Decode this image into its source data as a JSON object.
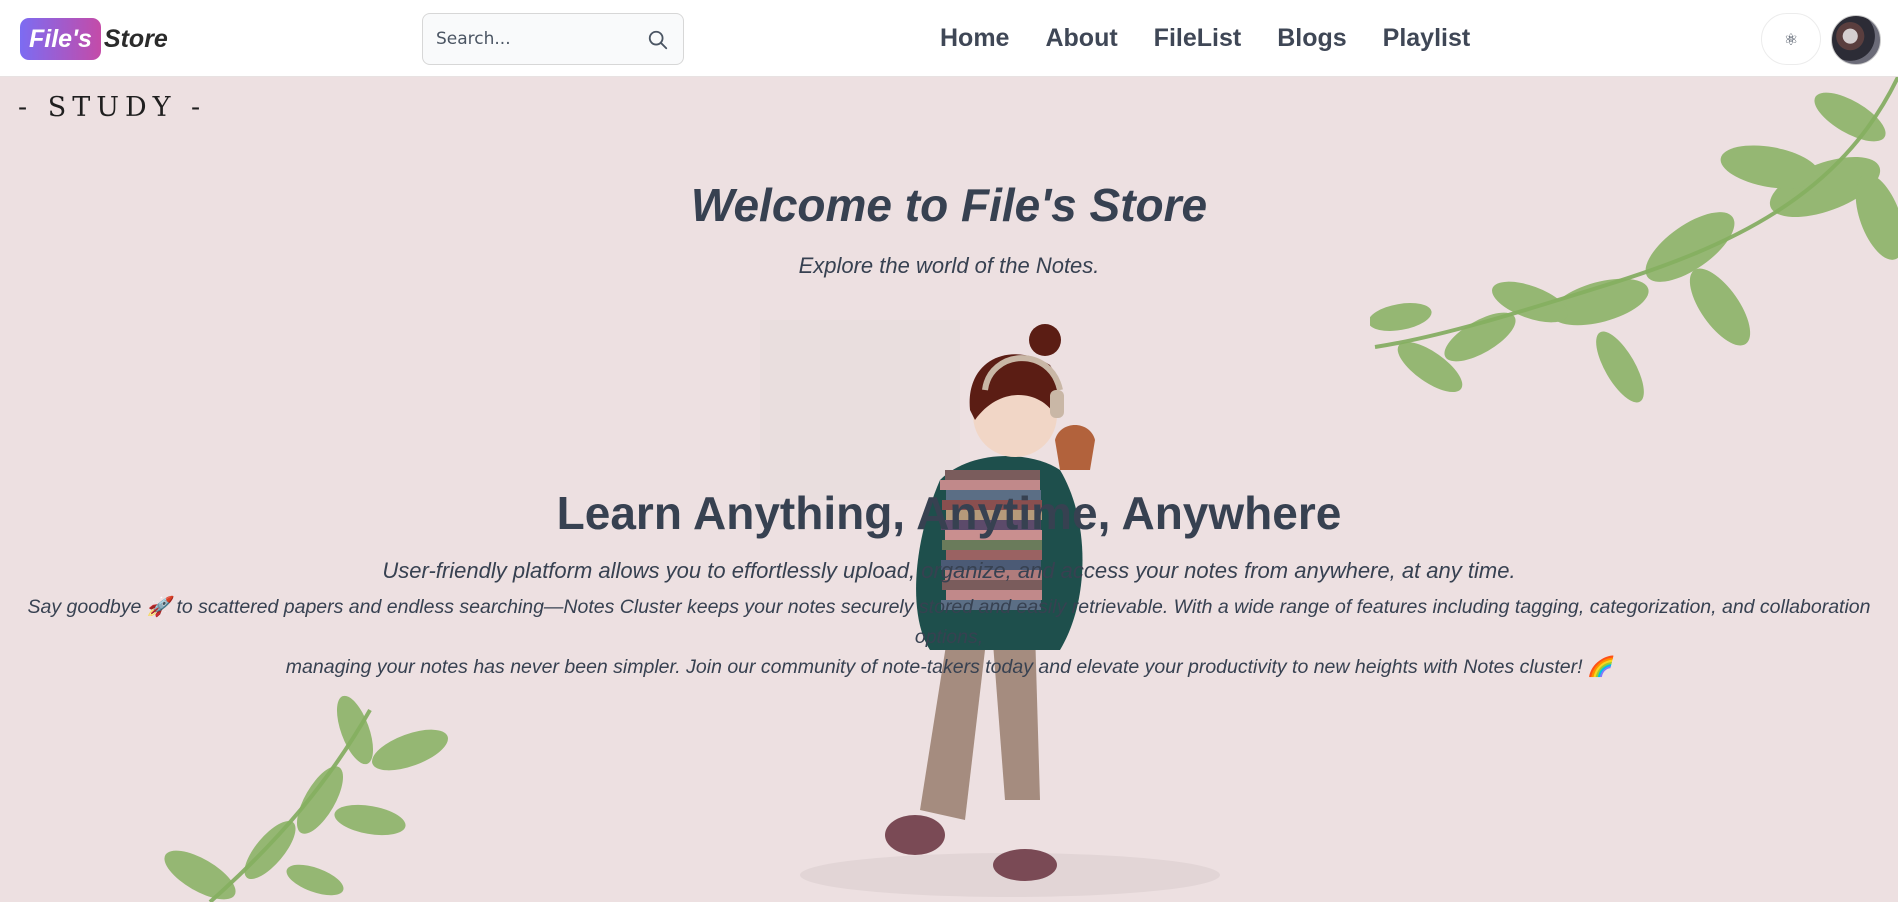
{
  "header": {
    "logo": {
      "badge": "File's",
      "rest": "Store"
    },
    "search": {
      "placeholder": "Search..."
    },
    "nav": [
      "Home",
      "About",
      "FileList",
      "Blogs",
      "Playlist"
    ],
    "theme_toggle_icon": "⚛"
  },
  "hero": {
    "label": "- STUDY -",
    "title": "Welcome to File's Store",
    "subtitle": "Explore the world of the Notes."
  },
  "content": {
    "heading": "Learn Anything, Anytime, Anywhere",
    "tagline": "User-friendly platform allows you to effortlessly upload, organize, and access your notes from anywhere, at any time.",
    "description_line1": "Say goodbye 🚀 to scattered papers and endless searching—Notes Cluster keeps your notes securely stored and easily retrievable. With a wide range of features including tagging, categorization, and collaboration options,",
    "description_line2": "managing your notes has never been simpler. Join our community of note-takers today and elevate your productivity to new heights with Notes cluster! 🌈"
  },
  "icons": {
    "search": "search-icon",
    "theme": "atom-icon",
    "avatar": "user-avatar"
  },
  "colors": {
    "background": "#ede0e1",
    "text": "#374151",
    "logo_gradient_start": "#7c6cf2",
    "logo_gradient_end": "#c44ba8",
    "leaf": "#7fa95a"
  }
}
